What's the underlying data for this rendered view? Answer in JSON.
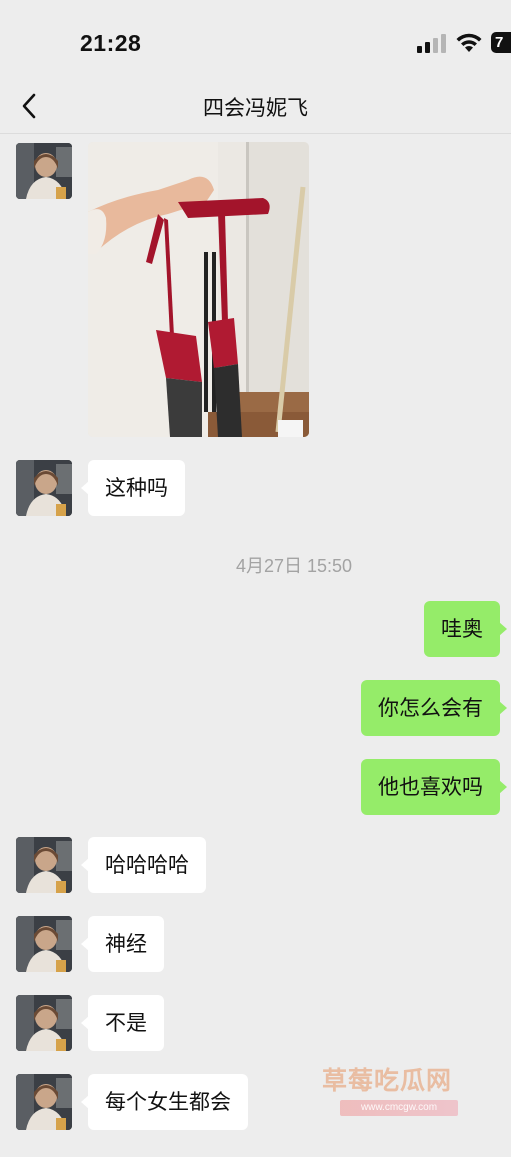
{
  "status_bar": {
    "time": "21:28",
    "battery": "7"
  },
  "header": {
    "back_icon": "chevron-left-icon",
    "title": "四会冯妮飞"
  },
  "messages": [
    {
      "side": "in",
      "type": "image",
      "image_description": "photo"
    },
    {
      "side": "in",
      "type": "text",
      "text": "这种吗"
    },
    {
      "side": "center",
      "type": "timestamp",
      "text": "4月27日 15:50"
    },
    {
      "side": "out",
      "type": "text",
      "text": "哇奥"
    },
    {
      "side": "out",
      "type": "text",
      "text": "你怎么会有"
    },
    {
      "side": "out",
      "type": "text",
      "text": "他也喜欢吗"
    },
    {
      "side": "in",
      "type": "text",
      "text": "哈哈哈哈"
    },
    {
      "side": "in",
      "type": "text",
      "text": "神经"
    },
    {
      "side": "in",
      "type": "text",
      "text": "不是"
    },
    {
      "side": "in",
      "type": "text",
      "text": "每个女生都会"
    }
  ],
  "watermark": {
    "text": "草莓吃瓜网",
    "url": "www.cmcgw.com"
  },
  "colors": {
    "background": "#ededed",
    "outgoing_bubble": "#95ec69",
    "incoming_bubble": "#ffffff"
  }
}
